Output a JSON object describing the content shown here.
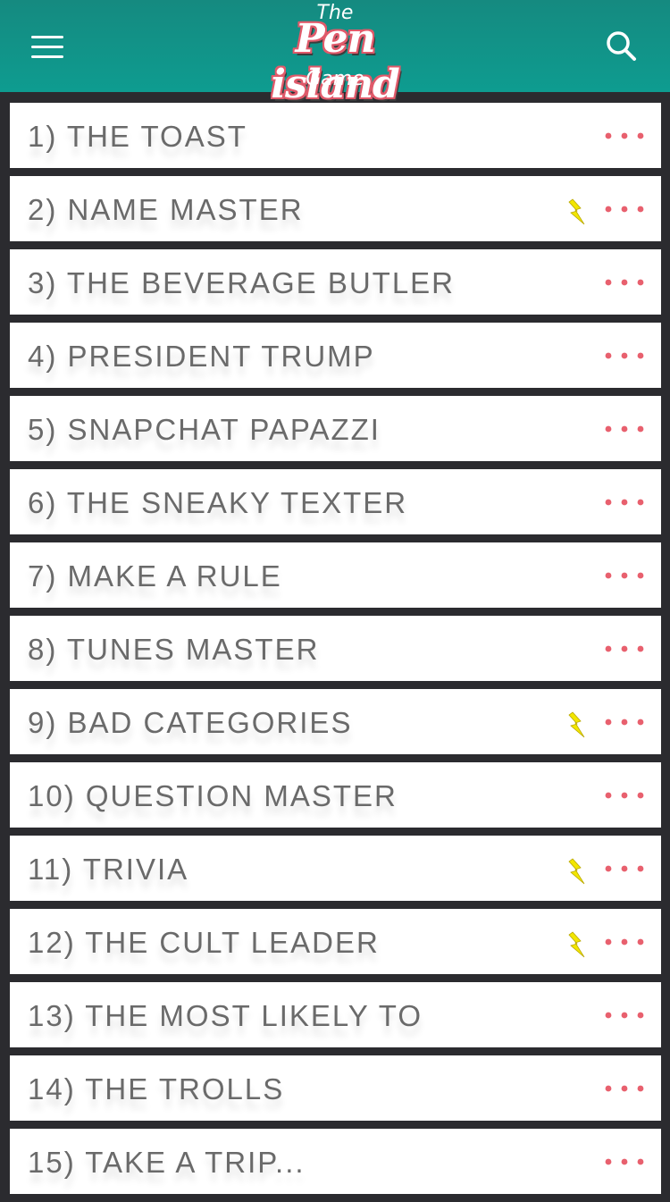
{
  "header": {
    "logo_the": "The",
    "logo_main": "Pen island",
    "logo_game": "Game",
    "menu_icon": "hamburger-menu-icon",
    "search_icon": "search-icon"
  },
  "colors": {
    "header": "#0e9c90",
    "accent_dots": "#e8606e",
    "bolt": "#f2e600",
    "row_text": "#6a6a6a",
    "background": "#2b2b2f"
  },
  "games": [
    {
      "label": "1) THE TOAST",
      "featured": false
    },
    {
      "label": "2) NAME MASTER",
      "featured": true
    },
    {
      "label": "3) THE BEVERAGE BUTLER",
      "featured": false
    },
    {
      "label": "4) PRESIDENT TRUMP",
      "featured": false
    },
    {
      "label": "5) SNAPCHAT PAPAZZI",
      "featured": false
    },
    {
      "label": "6) THE SNEAKY TEXTER",
      "featured": false
    },
    {
      "label": "7) MAKE A RULE",
      "featured": false
    },
    {
      "label": "8) TUNES MASTER",
      "featured": false
    },
    {
      "label": "9) BAD CATEGORIES",
      "featured": true
    },
    {
      "label": "10) QUESTION MASTER",
      "featured": false
    },
    {
      "label": "11) TRIVIA",
      "featured": true
    },
    {
      "label": "12) THE CULT LEADER",
      "featured": true
    },
    {
      "label": "13) THE MOST LIKELY TO",
      "featured": false
    },
    {
      "label": "14) THE TROLLS",
      "featured": false
    },
    {
      "label": "15) TAKE A TRIP...",
      "featured": false
    }
  ]
}
